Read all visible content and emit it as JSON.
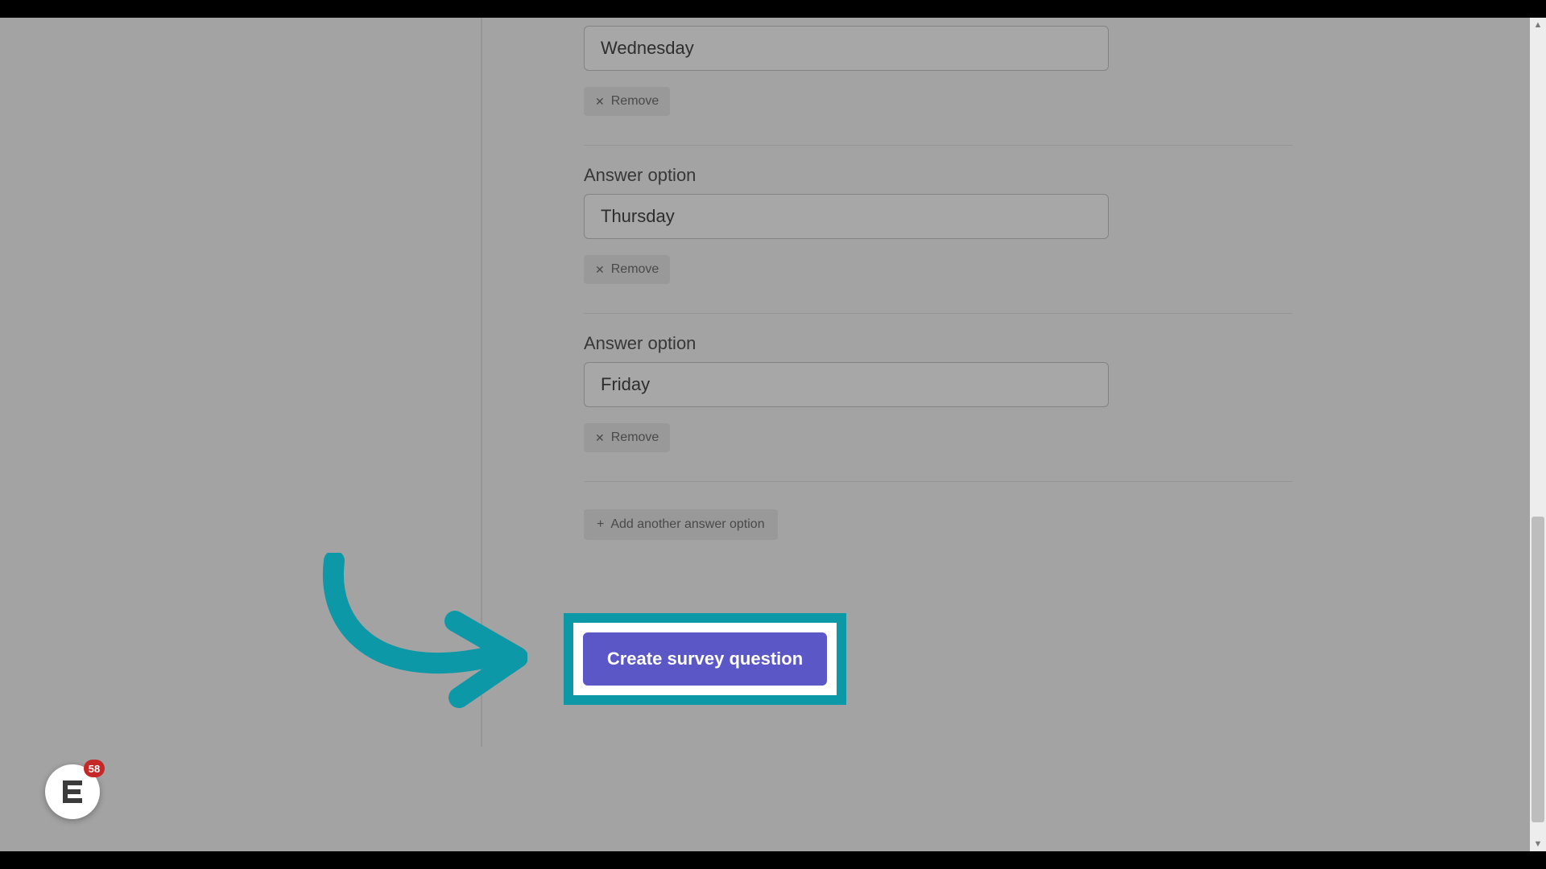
{
  "options": [
    {
      "label": "",
      "value": "Wednesday",
      "remove": "Remove"
    },
    {
      "label": "Answer option",
      "value": "Thursday",
      "remove": "Remove"
    },
    {
      "label": "Answer option",
      "value": "Friday",
      "remove": "Remove"
    }
  ],
  "add_another": "Add another answer option",
  "create_button": "Create survey question",
  "widget_badge": "58",
  "colors": {
    "highlight": "#0d98a8",
    "primary_button": "#5b57c7"
  }
}
